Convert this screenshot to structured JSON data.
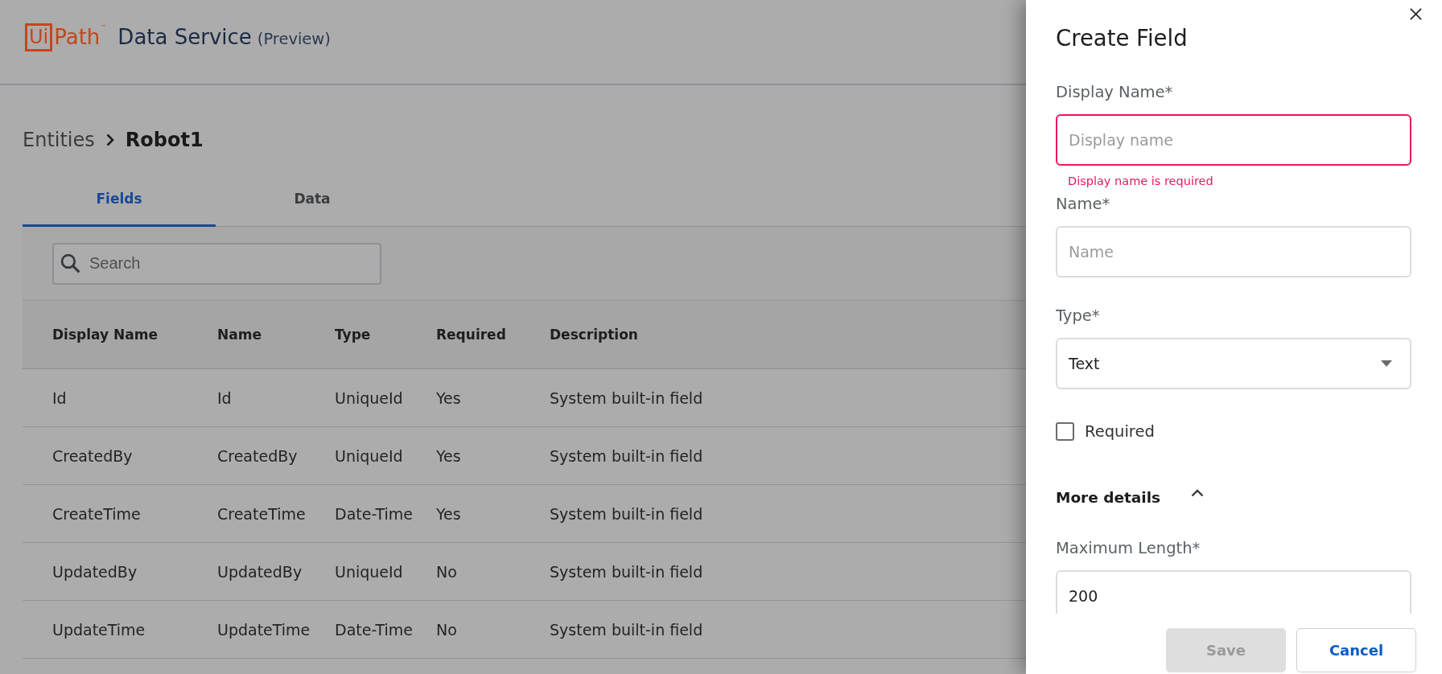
{
  "header": {
    "logo": {
      "boxed": "Ui",
      "text": "Path",
      "trademark": "™"
    },
    "title": "Data Service",
    "subtitle": "(Preview)"
  },
  "breadcrumb": [
    {
      "label": "Entities",
      "current": false
    },
    {
      "label": "Robot1",
      "current": true
    }
  ],
  "tabs": [
    {
      "label": "Fields",
      "selected": true
    },
    {
      "label": "Data",
      "selected": false
    }
  ],
  "search": {
    "placeholder": "Search"
  },
  "table": {
    "columns": [
      "Display Name",
      "Name",
      "Type",
      "Required",
      "Description"
    ],
    "rows": [
      [
        "Id",
        "Id",
        "UniqueId",
        "Yes",
        "System built-in field"
      ],
      [
        "CreatedBy",
        "CreatedBy",
        "UniqueId",
        "Yes",
        "System built-in field"
      ],
      [
        "CreateTime",
        "CreateTime",
        "Date-Time",
        "Yes",
        "System built-in field"
      ],
      [
        "UpdatedBy",
        "UpdatedBy",
        "UniqueId",
        "No",
        "System built-in field"
      ],
      [
        "UpdateTime",
        "UpdateTime",
        "Date-Time",
        "No",
        "System built-in field"
      ]
    ]
  },
  "panel": {
    "title": "Create Field",
    "fields": [
      {
        "kind": "text",
        "label": "Display Name*",
        "placeholder": "Display name",
        "error": "Display name is required"
      },
      {
        "kind": "text",
        "label": "Name*",
        "placeholder": "Name"
      },
      {
        "kind": "select",
        "label": "Type*",
        "value": "Text"
      },
      {
        "kind": "checkbox",
        "label": "Required",
        "checked": false
      }
    ],
    "more_details": {
      "label": "More details",
      "expanded": true,
      "fields": [
        {
          "kind": "text",
          "label": "Maximum Length*",
          "value": "200"
        }
      ]
    },
    "buttons": [
      {
        "label": "Save",
        "disabled": true
      },
      {
        "label": "Cancel",
        "disabled": false
      }
    ]
  }
}
